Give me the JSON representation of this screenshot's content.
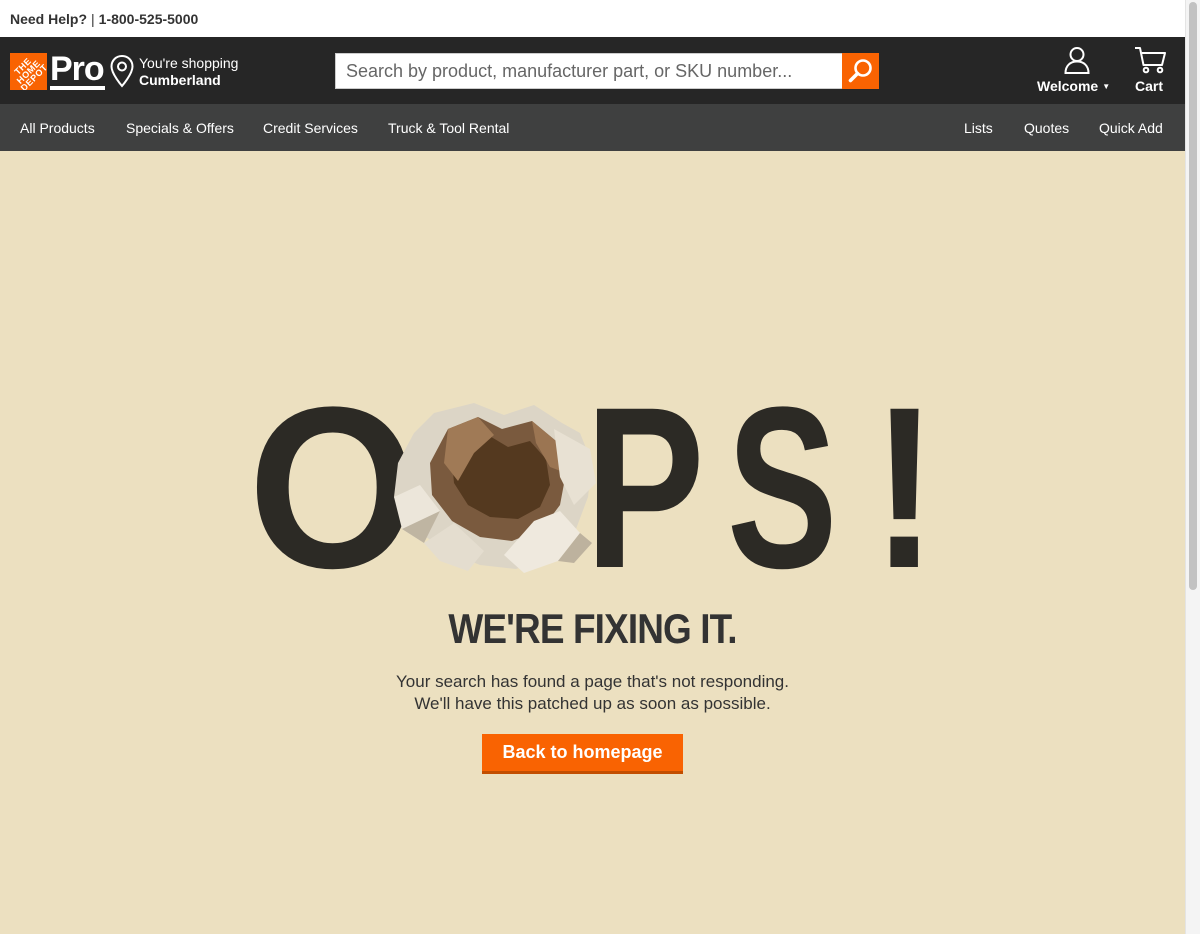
{
  "topbar": {
    "help_label": "Need Help?",
    "separator": "|",
    "phone": "1-800-525-5000"
  },
  "header": {
    "logo_text": "THE HOME DEPOT",
    "pro_text": "Pro",
    "store_line1": "You're shopping",
    "store_city": "Cumberland",
    "search_placeholder": "Search by product, manufacturer part, or SKU number...",
    "account_label": "Welcome",
    "cart_label": "Cart"
  },
  "nav": {
    "left": [
      "All Products",
      "Specials & Offers",
      "Credit Services",
      "Truck & Tool Rental"
    ],
    "right": [
      "Lists",
      "Quotes",
      "Quick Add"
    ]
  },
  "error": {
    "oops_letters": [
      "O",
      "P",
      "S",
      "!"
    ],
    "headline": "WE'RE FIXING IT.",
    "line1": "Your search has found a page that's not responding.",
    "line2": "We'll have this patched up as soon as possible.",
    "button_label": "Back to homepage"
  },
  "colors": {
    "brand_orange": "#f96302",
    "header_bg": "#262626",
    "nav_bg": "#3f4040",
    "page_bg": "#ece0c0",
    "oops_text": "#2c2a25"
  }
}
